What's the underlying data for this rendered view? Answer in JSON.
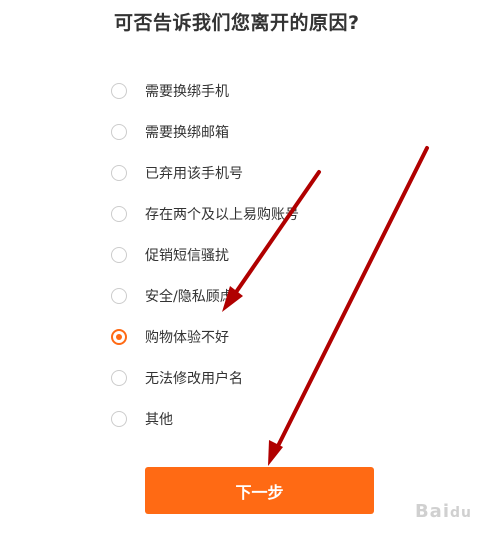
{
  "form": {
    "title": "可否告诉我们您离开的原因?",
    "options": [
      {
        "label": "需要换绑手机",
        "checked": false
      },
      {
        "label": "需要换绑邮箱",
        "checked": false
      },
      {
        "label": "已弃用该手机号",
        "checked": false
      },
      {
        "label": "存在两个及以上易购账号",
        "checked": false
      },
      {
        "label": "促销短信骚扰",
        "checked": false
      },
      {
        "label": "安全/隐私顾虑",
        "checked": false
      },
      {
        "label": "购物体验不好",
        "checked": true
      },
      {
        "label": "无法修改用户名",
        "checked": false
      },
      {
        "label": "其他",
        "checked": false
      }
    ],
    "next_label": "下一步"
  },
  "colors": {
    "accent": "#ff6a14",
    "annotation_arrow": "#b00000"
  },
  "watermark": {
    "text": "Baidu"
  }
}
